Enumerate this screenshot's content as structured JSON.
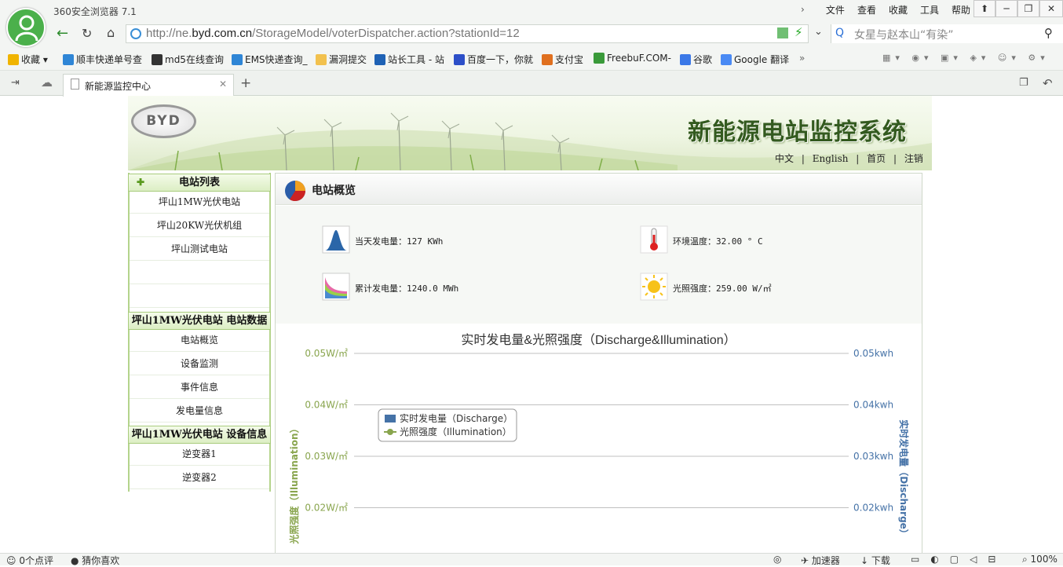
{
  "browser": {
    "app_title": "360安全浏览器 7.1",
    "menu": [
      "文件",
      "查看",
      "收藏",
      "工具",
      "帮助"
    ],
    "url_prefix": "http://ne.",
    "url_domain": "byd.com.cn",
    "url_path": "/StorageModel/voterDispatcher.action?stationId=12",
    "search_text": "女星与赵本山“有染”",
    "bookmarks": [
      "收藏",
      "顺丰快递单号查",
      "md5在线查询",
      "EMS快递查询_",
      "漏洞提交",
      "站长工具 - 站",
      "百度一下，你就",
      "支付宝",
      "FreebuF.COM-",
      "谷歌",
      "Google 翻译"
    ],
    "tab_title": "新能源监控中心",
    "status_left": [
      "0个点评",
      "猜你喜欢"
    ],
    "status_right": [
      "加速器",
      "下载",
      "100%"
    ]
  },
  "header": {
    "logo": "BYD",
    "system_title": "新能源电站监控系统",
    "lang_links": [
      "中文",
      "English",
      "首页",
      "注销"
    ]
  },
  "sidebar": {
    "sections": [
      {
        "title": "电站列表",
        "items": [
          "坪山1MW光伏电站",
          "坪山20KW光伏机组",
          "坪山测试电站"
        ]
      },
      {
        "title": "坪山1MW光伏电站 电站数据",
        "items": [
          "电站概览",
          "设备监测",
          "事件信息",
          "发电量信息"
        ]
      },
      {
        "title": "坪山1MW光伏电站 设备信息",
        "items": [
          "逆变器1",
          "逆变器2"
        ]
      }
    ]
  },
  "overview": {
    "title": "电站概览",
    "today_energy": "当天发电量：127 KWh",
    "env_temp": "环境温度：32.00 ° C",
    "total_energy": "累计发电量：1240.0 MWh",
    "illumination": "光照强度：259.00 W/㎡"
  },
  "chart_data": {
    "type": "line",
    "title": "实时发电量&光照强度（Discharge&Illumination）",
    "left_axis_label": "光照强度（Illumination）",
    "right_axis_label": "实时发电量（Discharge）",
    "left_ticks": [
      "0.05W/㎡",
      "0.04W/㎡",
      "0.03W/㎡",
      "0.02W/㎡"
    ],
    "right_ticks": [
      "0.05kwh",
      "0.04kwh",
      "0.03kwh",
      "0.02kwh"
    ],
    "series": [
      {
        "name": "实时发电量（Discharge）",
        "type": "bar",
        "color": "#4572a7",
        "values": []
      },
      {
        "name": "光照强度（Illumination）",
        "type": "line",
        "color": "#89a54e",
        "values": []
      }
    ],
    "legend_position": "top-left",
    "grid": true
  }
}
